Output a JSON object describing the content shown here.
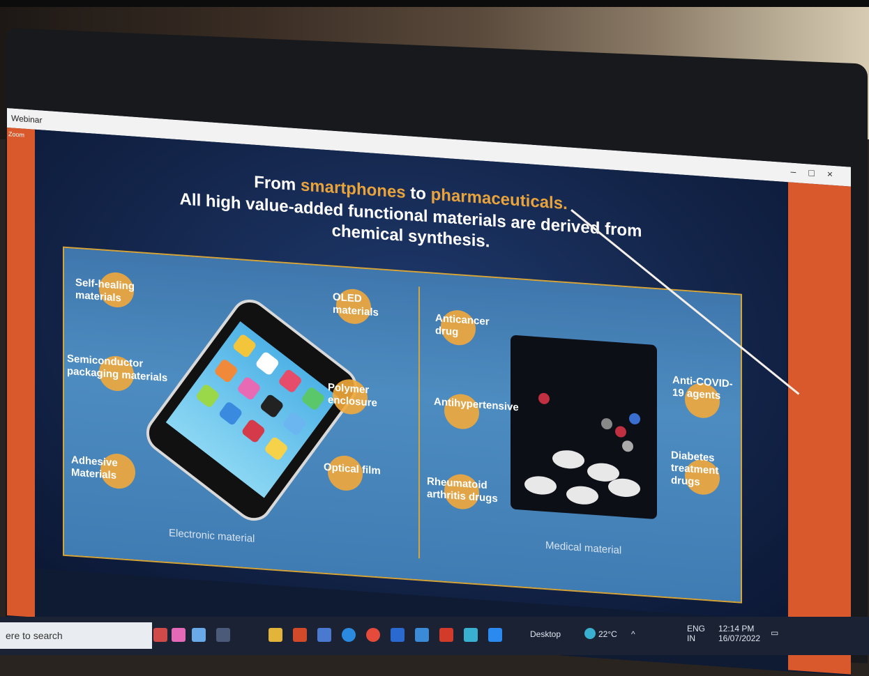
{
  "window": {
    "title": "Webinar",
    "side_tag": "Zoom",
    "controls": [
      "–",
      "□",
      "×"
    ]
  },
  "slide": {
    "line1_pre": "From ",
    "line1_hl1": "smartphones",
    "line1_mid": " to ",
    "line1_hl2": "pharmaceuticals",
    "line1_post": ".",
    "line2": "All high value-added functional materials are derived from",
    "line3": "chemical synthesis.",
    "left_labels": {
      "a": "Self-healing materials",
      "b": "Semiconductor packaging materials",
      "c": "Adhesive Materials",
      "d": "OLED materials",
      "e": "Polymer enclosure",
      "f": "Optical film"
    },
    "left_caption": "Electronic material",
    "right_labels": {
      "a": "Anticancer drug",
      "b": "Antihypertensive",
      "c": "Rheumatoid arthritis drugs",
      "d": "Anti-COVID-19 agents",
      "e": "Diabetes treatment drugs"
    },
    "right_caption": "Medical material"
  },
  "taskbar": {
    "search_placeholder": "ere to search",
    "desktop_label": "Desktop",
    "weather": "22°C",
    "lang": "ENG",
    "region": "IN",
    "time": "12:14 PM",
    "date": "16/07/2022"
  },
  "colors": {
    "accent": "#e8a33d",
    "slide_bg": "#14264c",
    "panel_border": "#d6a53a",
    "zoom_orange": "#d9592c"
  }
}
